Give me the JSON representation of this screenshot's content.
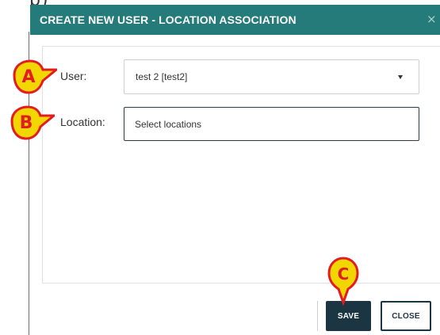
{
  "window_fragment": "p)",
  "dialog": {
    "title": "CREATE NEW USER - LOCATION ASSOCIATION",
    "close_icon": "×"
  },
  "form": {
    "user_label": "User:",
    "user_value": "test 2 [test2]",
    "location_label": "Location:",
    "location_placeholder": "Select locations"
  },
  "footer": {
    "save_label": "SAVE",
    "close_label": "CLOSE"
  },
  "callouts": {
    "a": "A",
    "b": "B",
    "c": "C"
  },
  "colors": {
    "header": "#247b79",
    "button_dark": "#1c3543",
    "callout_fill": "#f2d600",
    "callout_stroke": "#e31c23"
  },
  "icons": {
    "close": "close-icon",
    "dropdown": "chevron-down-icon"
  }
}
